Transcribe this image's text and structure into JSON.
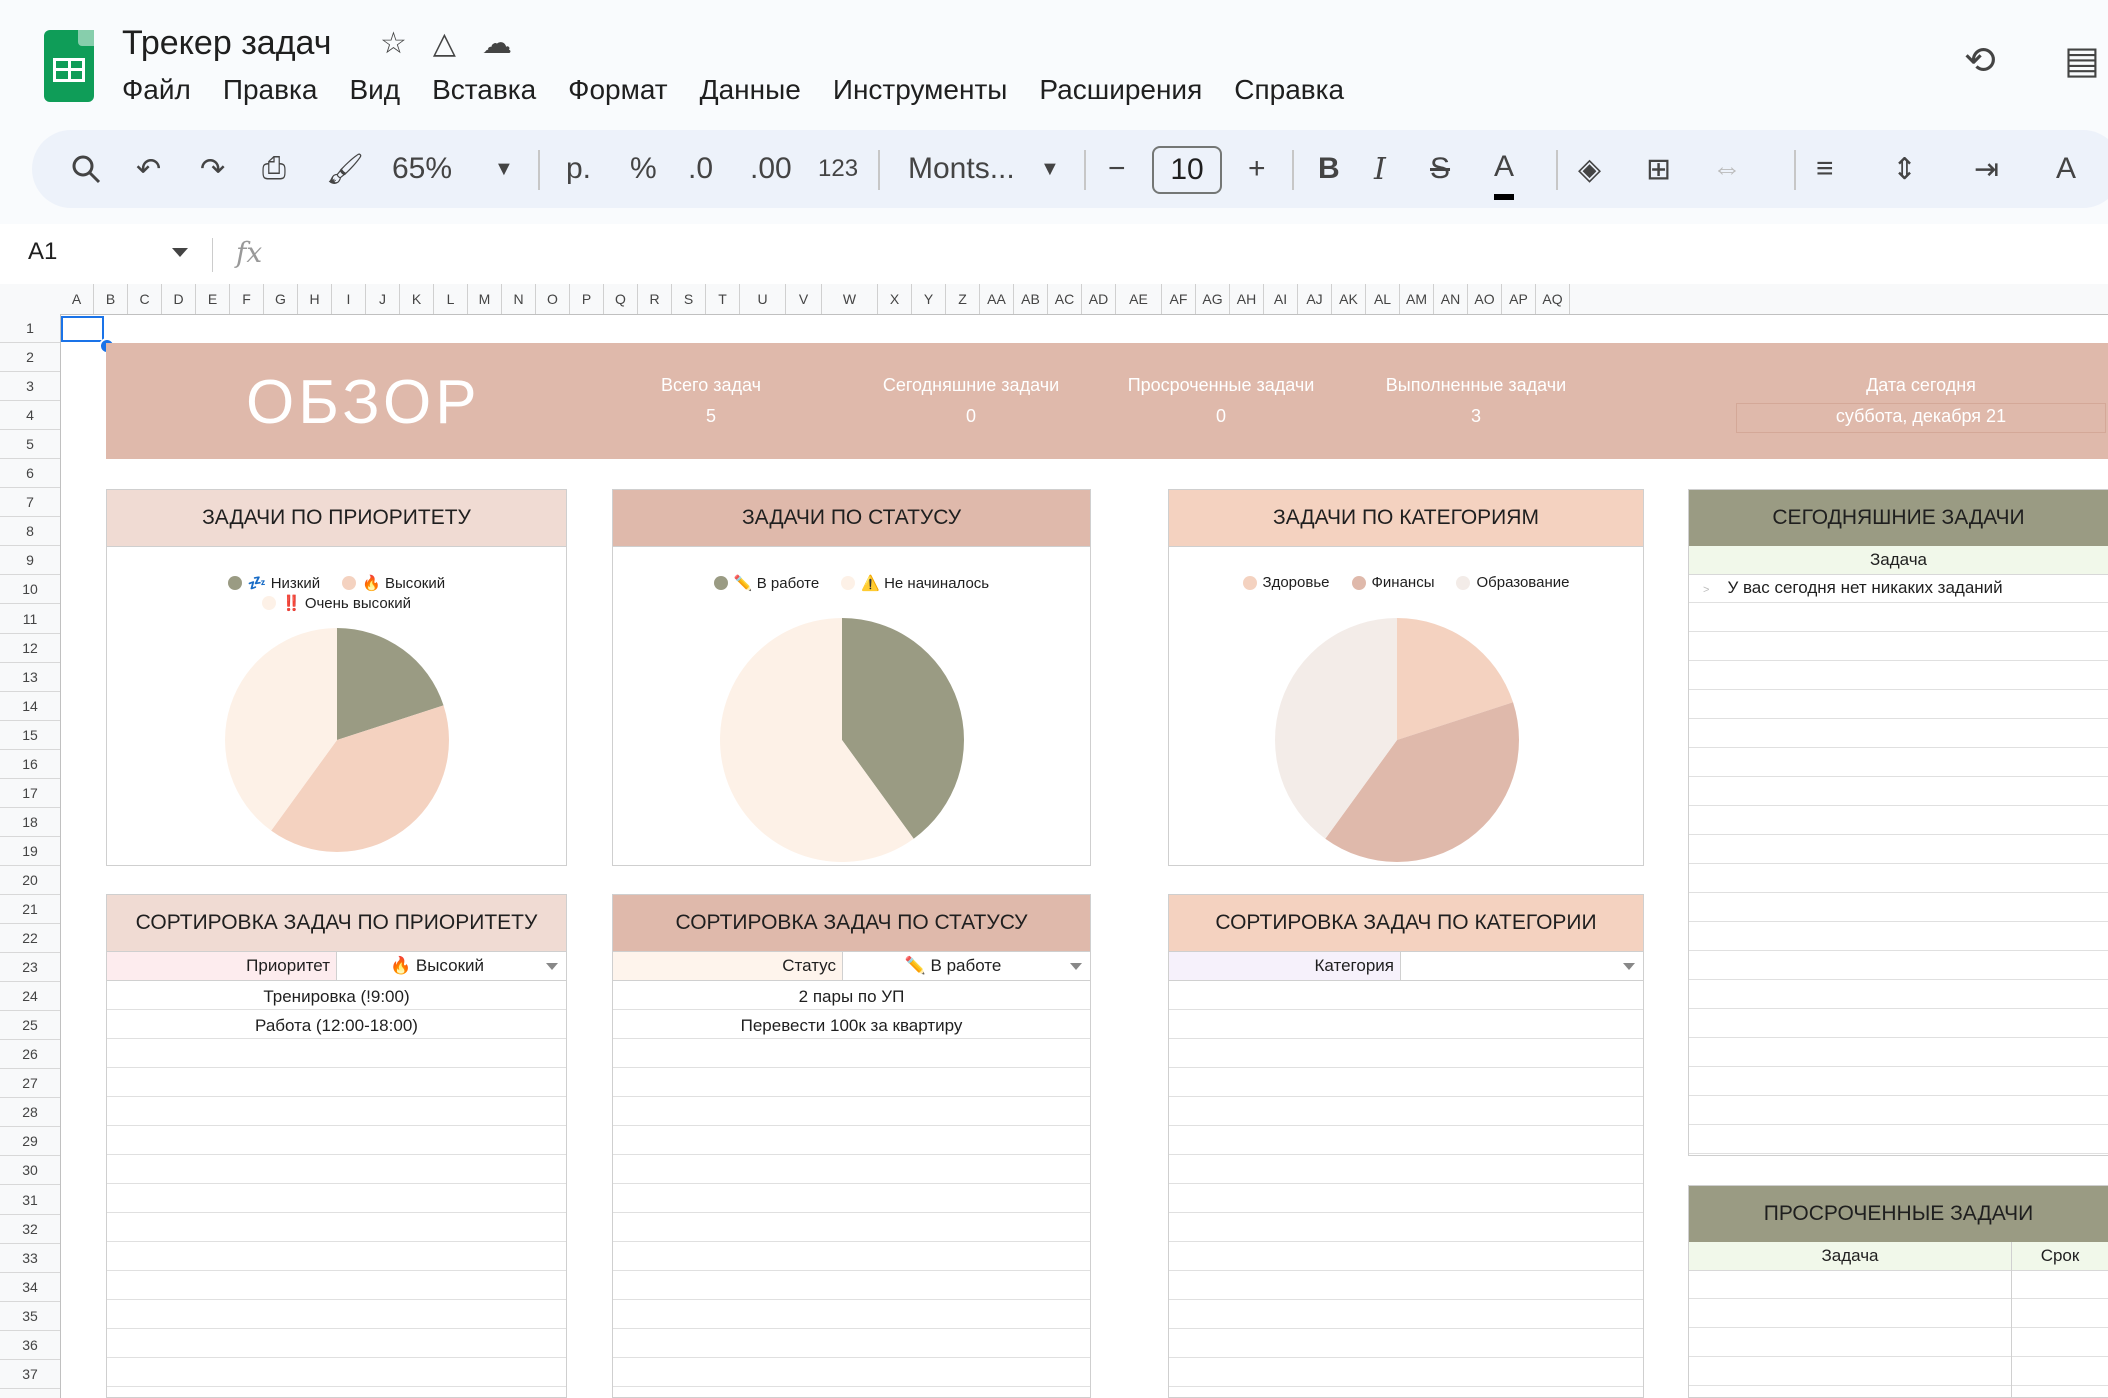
{
  "doc": {
    "title": "Трекер задач"
  },
  "menu": [
    "Файл",
    "Правка",
    "Вид",
    "Вставка",
    "Формат",
    "Данные",
    "Инструменты",
    "Расширения",
    "Справка"
  ],
  "toolbar": {
    "zoom": "65%",
    "currency": "р.",
    "percent": "%",
    "dec_minus": ".0",
    "dec_plus": ".00",
    "num_format": "123",
    "font": "Monts...",
    "font_size": "10",
    "bold": "B",
    "italic": "I"
  },
  "formula_bar": {
    "cell_ref": "A1",
    "fx": "fx"
  },
  "columns": [
    "A",
    "B",
    "C",
    "D",
    "E",
    "F",
    "G",
    "H",
    "I",
    "J",
    "K",
    "L",
    "M",
    "N",
    "O",
    "P",
    "Q",
    "R",
    "S",
    "T",
    "U",
    "V",
    "W",
    "X",
    "Y",
    "Z",
    "AA",
    "AB",
    "AC",
    "AD",
    "AE",
    "AF",
    "AG",
    "AH",
    "AI",
    "AJ",
    "AK",
    "AL",
    "AM",
    "AN",
    "AO",
    "AP",
    "AQ"
  ],
  "rows": [
    "1",
    "2",
    "3",
    "4",
    "5",
    "6",
    "7",
    "8",
    "9",
    "10",
    "11",
    "12",
    "13",
    "14",
    "15",
    "16",
    "17",
    "18",
    "19",
    "20",
    "21",
    "22",
    "23",
    "24",
    "25",
    "26",
    "27",
    "28",
    "29",
    "30",
    "31",
    "32",
    "33",
    "34",
    "35",
    "36",
    "37"
  ],
  "overview": {
    "title": "ОБЗОР",
    "stats": [
      {
        "label": "Всего задач",
        "value": "5"
      },
      {
        "label": "Сегодняшние задачи",
        "value": "0"
      },
      {
        "label": "Просроченные задачи",
        "value": "0"
      },
      {
        "label": "Выполненные задачи",
        "value": "3"
      }
    ],
    "date_label": "Дата сегодня",
    "date_value": "суббота, декабря 21"
  },
  "charts": {
    "priority": {
      "title": "ЗАДАЧИ ПО ПРИОРИТЕТУ",
      "header_color": "#f0dbd3"
    },
    "status": {
      "title": "ЗАДАЧИ ПО СТАТУСУ",
      "header_color": "#dfb9ab"
    },
    "category": {
      "title": "ЗАДАЧИ ПО КАТЕГОРИЯМ",
      "header_color": "#f4d2c0"
    }
  },
  "chart_data": [
    {
      "type": "pie",
      "title": "ЗАДАЧИ ПО ПРИОРИТЕТУ",
      "series": [
        {
          "name": "💤 Низкий",
          "value": 1,
          "color": "#9a9b83"
        },
        {
          "name": "🔥 Высокий",
          "value": 2,
          "color": "#f4d2c0"
        },
        {
          "name": "‼️ Очень высокий",
          "value": 2,
          "color": "#fdf1e7"
        }
      ]
    },
    {
      "type": "pie",
      "title": "ЗАДАЧИ ПО СТАТУСУ",
      "series": [
        {
          "name": "✏️ В работе",
          "value": 2,
          "color": "#9a9b83"
        },
        {
          "name": "⚠️ Не начиналось",
          "value": 3,
          "color": "#fdf1e7"
        }
      ]
    },
    {
      "type": "pie",
      "title": "ЗАДАЧИ ПО КАТЕГОРИЯМ",
      "series": [
        {
          "name": "Здоровье",
          "value": 1,
          "color": "#f4d2c0"
        },
        {
          "name": "Финансы",
          "value": 2,
          "color": "#dfb9ab"
        },
        {
          "name": "Образование",
          "value": 2,
          "color": "#f3ece8"
        }
      ]
    }
  ],
  "sorts": {
    "priority": {
      "title": "СОРТИРОВКА ЗАДАЧ ПО ПРИОРИТЕТУ",
      "header_color": "#f0dbd3",
      "filter_label": "Приоритет",
      "filter_value": "🔥 Высокий",
      "label_bg": "#fdecee",
      "items": [
        "Тренировка (!9:00)",
        "Работа (12:00-18:00)"
      ]
    },
    "status": {
      "title": "СОРТИРОВКА ЗАДАЧ ПО СТАТУСУ",
      "header_color": "#dfb9ab",
      "filter_label": "Статус",
      "filter_value": "✏️ В работе",
      "label_bg": "#fef4ec",
      "items": [
        "2 пары по УП",
        "Перевести 100к за квартиру"
      ]
    },
    "category": {
      "title": "СОРТИРОВКА ЗАДАЧ ПО КАТЕГОРИИ",
      "header_color": "#f4d2c0",
      "filter_label": "Категория",
      "filter_value": "",
      "label_bg": "#f6f1fb",
      "items": []
    }
  },
  "today_panel": {
    "title": "СЕГОДНЯШНИЕ ЗАДАЧИ",
    "col": "Задача",
    "empty": "У вас сегодня нет никаких заданий"
  },
  "overdue_panel": {
    "title": "ПРОСРОЧЕННЫЕ ЗАДАЧИ",
    "col_task": "Задача",
    "col_due": "Срок"
  }
}
